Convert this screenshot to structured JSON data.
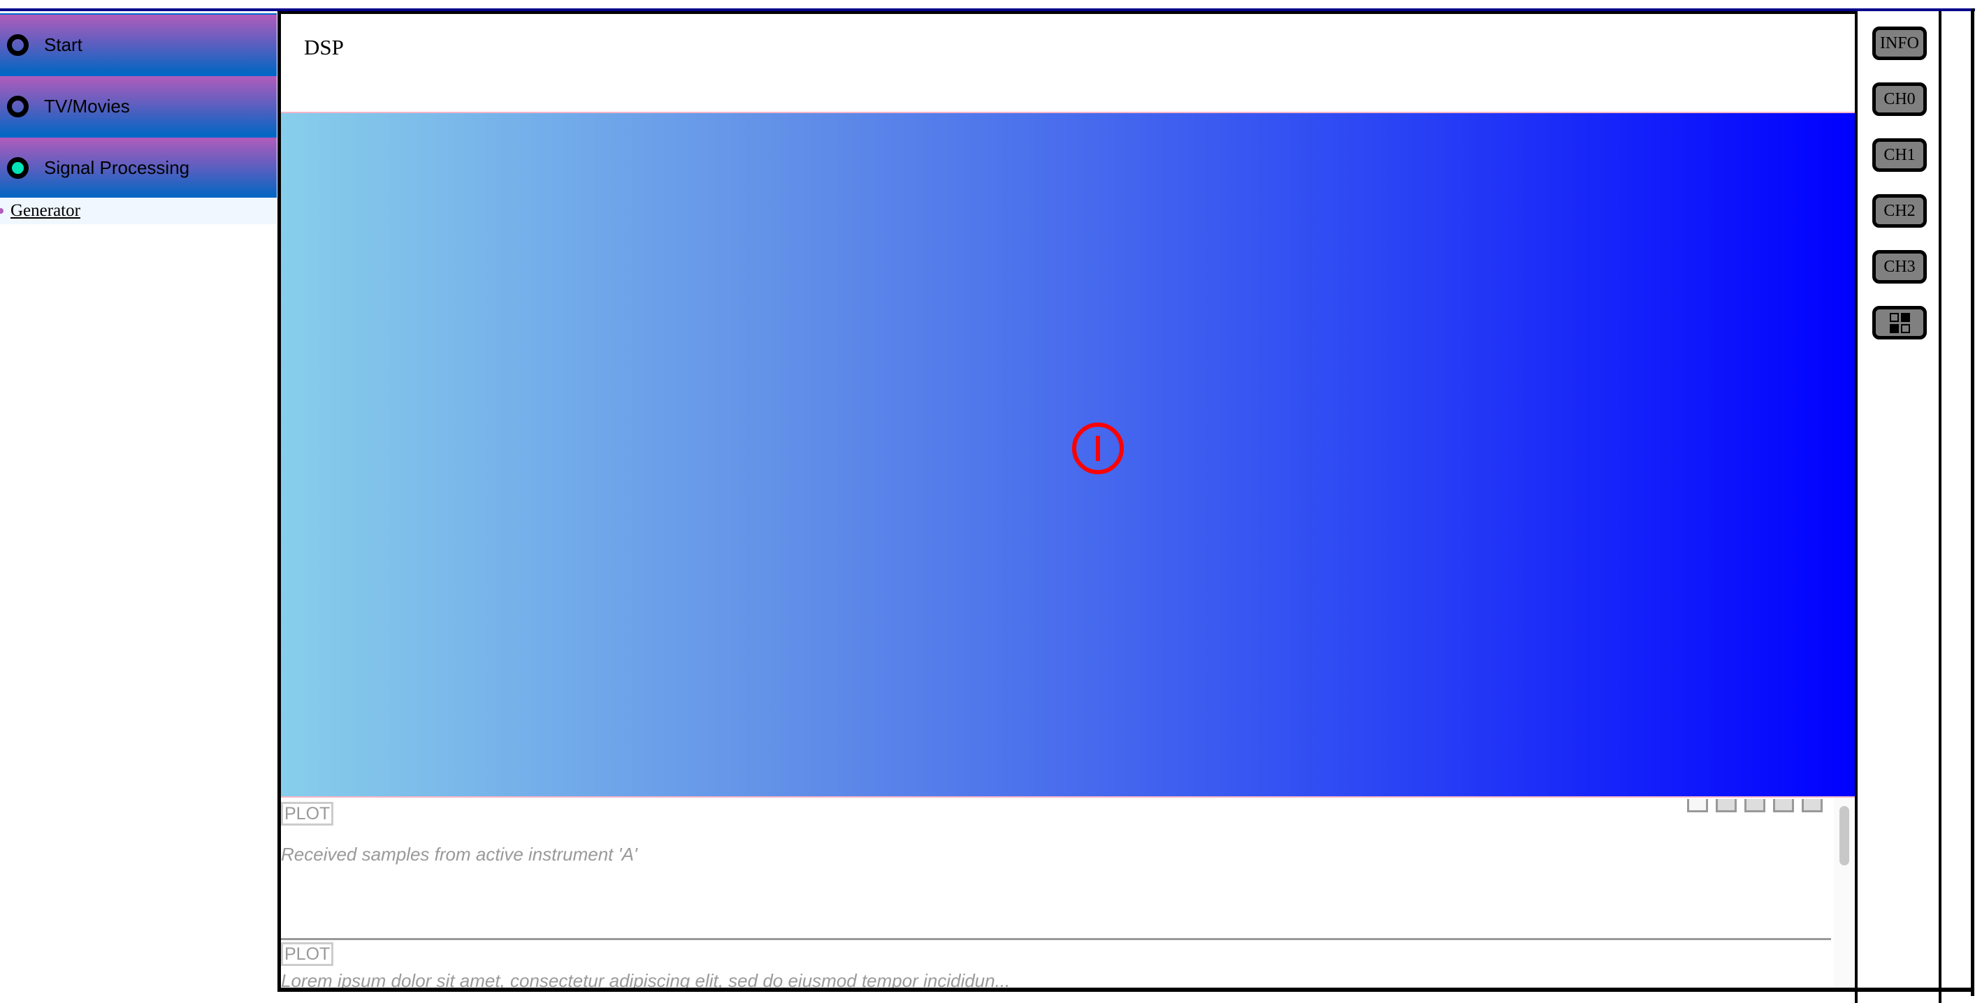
{
  "sidebar": {
    "items": [
      {
        "label": "Start",
        "active": false
      },
      {
        "label": "TV/Movies",
        "active": false
      },
      {
        "label": "Signal Processing",
        "active": true
      }
    ],
    "sub_items": [
      {
        "label": "Generator"
      }
    ]
  },
  "main": {
    "title": "DSP",
    "power_icon": "power-icon",
    "panels": [
      {
        "tag": "PLOT",
        "description": "Received samples from active instrument 'A'"
      },
      {
        "tag": "PLOT",
        "description": "Lorem ipsum dolor sit amet, consectetur adipiscing elit, sed do eiusmod tempor incididun..."
      }
    ]
  },
  "right_buttons": [
    "INFO",
    "CH0",
    "CH1",
    "CH2",
    "CH3"
  ],
  "colors": {
    "gradient_start": "#87ceeb",
    "gradient_end": "#0000ff",
    "power": "#ff0000",
    "active_dot": "#00e5b8"
  }
}
